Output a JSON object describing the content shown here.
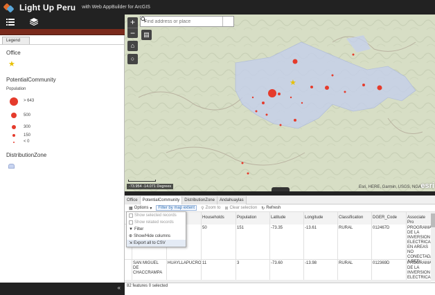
{
  "header": {
    "title": "Light Up Peru",
    "subtitle": "with Web AppBuilder for ArcGIS"
  },
  "toolbar": {
    "icons": [
      "list-icon",
      "layers-icon"
    ]
  },
  "legend": {
    "tab_label": "Legend",
    "office_heading": "Office",
    "community_heading": "PotentialCommunity",
    "population_label": "Population",
    "population_classes": [
      "> 643",
      "500",
      "300",
      "150",
      "< 0"
    ],
    "zone_heading": "DistributionZone",
    "colors": {
      "community": "#e53b2c",
      "office": "#e8c000",
      "zone": "#c8d4f0"
    }
  },
  "map": {
    "search_placeholder": "Find address or place",
    "coordinates": "-73.954 -14.071 Degrees",
    "attribution": "Esri, HERE, Garmin, USGS, NGA",
    "brand": "esri"
  },
  "table": {
    "tabs": [
      "Office",
      "PotentialCommunity",
      "DistributionZone",
      "Andahuaylas"
    ],
    "actions": {
      "options": "Options",
      "filter_by_extent": "Filter by map extent",
      "zoom_to": "Zoom to",
      "clear_selection": "Clear selection",
      "refresh": "Refresh"
    },
    "menu": [
      "Show selected records",
      "Show related records",
      "Filter",
      "Show/Hide columns",
      "Export all to CSV"
    ],
    "columns": [
      "",
      "",
      "Households",
      "Population",
      "Latitude",
      "Longitude",
      "Classification",
      "DGER_Code",
      "Associate Pro"
    ],
    "rows": [
      [
        "",
        "...IBA",
        "50",
        "151",
        "-73.35",
        "-13.61",
        "RURAL",
        "012467D",
        "PROGRAMA DE LA INVERSION ELECTRICA EN AREAS NO CONECTADAS A RED"
      ],
      [
        "SAN MIGUEL DE CHACCRAMPA",
        "HUAYLLAPUCRO",
        "11",
        "3",
        "-73.60",
        "-13.98",
        "RURAL",
        "012369D",
        "PROGRAMA DE LA INVERSION ELECTRICA EN AREAS NO"
      ]
    ],
    "status": "82 features 0 selected"
  }
}
